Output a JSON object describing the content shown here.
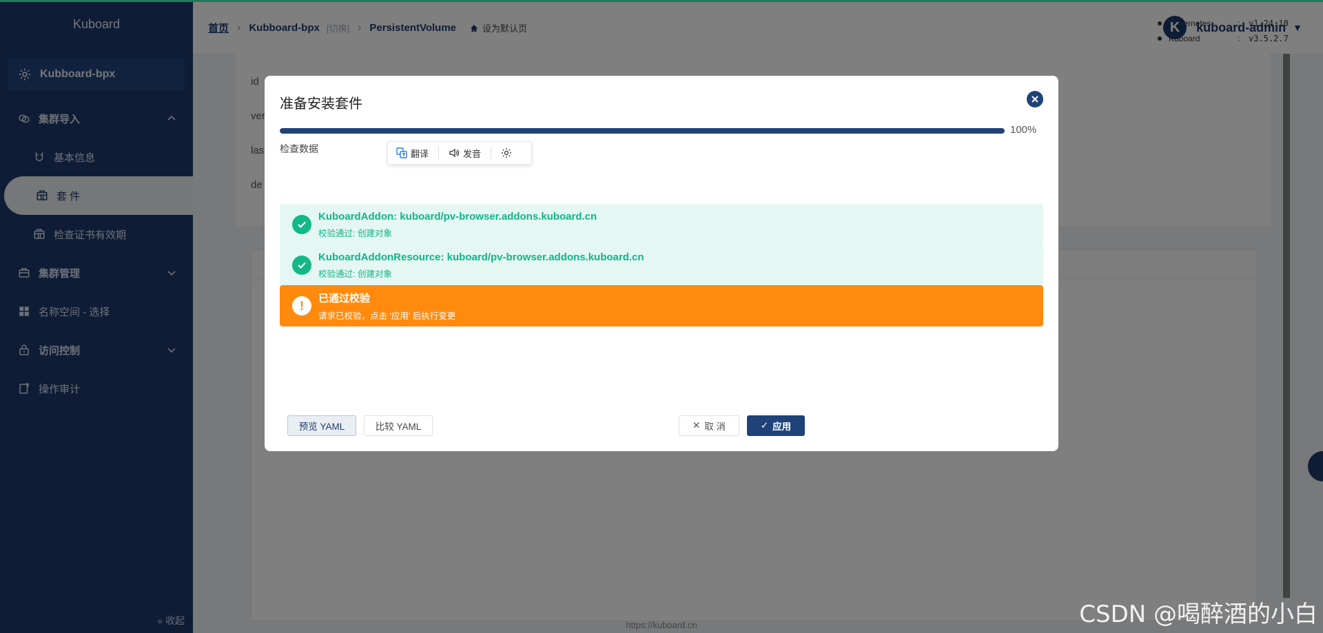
{
  "app": {
    "brand": "Kuboard"
  },
  "sidebar": {
    "cluster_name": "Kubboard-bpx",
    "items": [
      {
        "label": "集群导入",
        "bold": true
      },
      {
        "label": "基本信息"
      },
      {
        "label": "套 件",
        "active": true
      },
      {
        "label": "检查证书有效期"
      },
      {
        "label": "集群管理",
        "bold": true
      },
      {
        "label": "名称空间 - 选择"
      },
      {
        "label": "访问控制",
        "bold": true
      },
      {
        "label": "操作审计"
      }
    ],
    "collapse_label": "收起"
  },
  "header": {
    "breadcrumb": {
      "home": "首页",
      "cluster": "Kubboard-bpx",
      "switch": "[切换]",
      "current": "PersistentVolume",
      "set_default": "设为默认页"
    },
    "versions": [
      {
        "name": "Kubernetes",
        "value": "v1.24.10"
      },
      {
        "name": "Kuboard",
        "value": "v3.5.2.7"
      }
    ],
    "user": {
      "avatar_letter": "K",
      "name": "kuboard-admin"
    }
  },
  "background": {
    "labels": [
      "id",
      "ver",
      "las",
      "de"
    ],
    "footer": "https://kuboard.cn"
  },
  "dialog": {
    "title": "准备安装套件",
    "progress_percent": 100,
    "progress_label": "100%",
    "check_label": "检查数据",
    "tooltip": {
      "translate": "翻译",
      "pronounce": "发音"
    },
    "alerts": [
      {
        "type": "success",
        "title": "KuboardAddon: kuboard/pv-browser.addons.kuboard.cn",
        "detail": "校验通过: 创建对象"
      },
      {
        "type": "success",
        "title": "KuboardAddonResource: kuboard/pv-browser.addons.kuboard.cn",
        "detail": "校验通过: 创建对象"
      },
      {
        "type": "warning",
        "title": "已通过校验",
        "detail": "请求已校验，点击 '应用' 后执行变更"
      }
    ],
    "buttons": {
      "preview_yaml": "预览 YAML",
      "compare_yaml": "比较 YAML",
      "cancel": "取 消",
      "apply": "应用"
    }
  },
  "watermark": "CSDN @喝醉酒的小白",
  "colors": {
    "primary": "#1f4378",
    "sidebar": "#1c3a6b",
    "success": "#12b886",
    "warning": "#ff8a0e"
  }
}
